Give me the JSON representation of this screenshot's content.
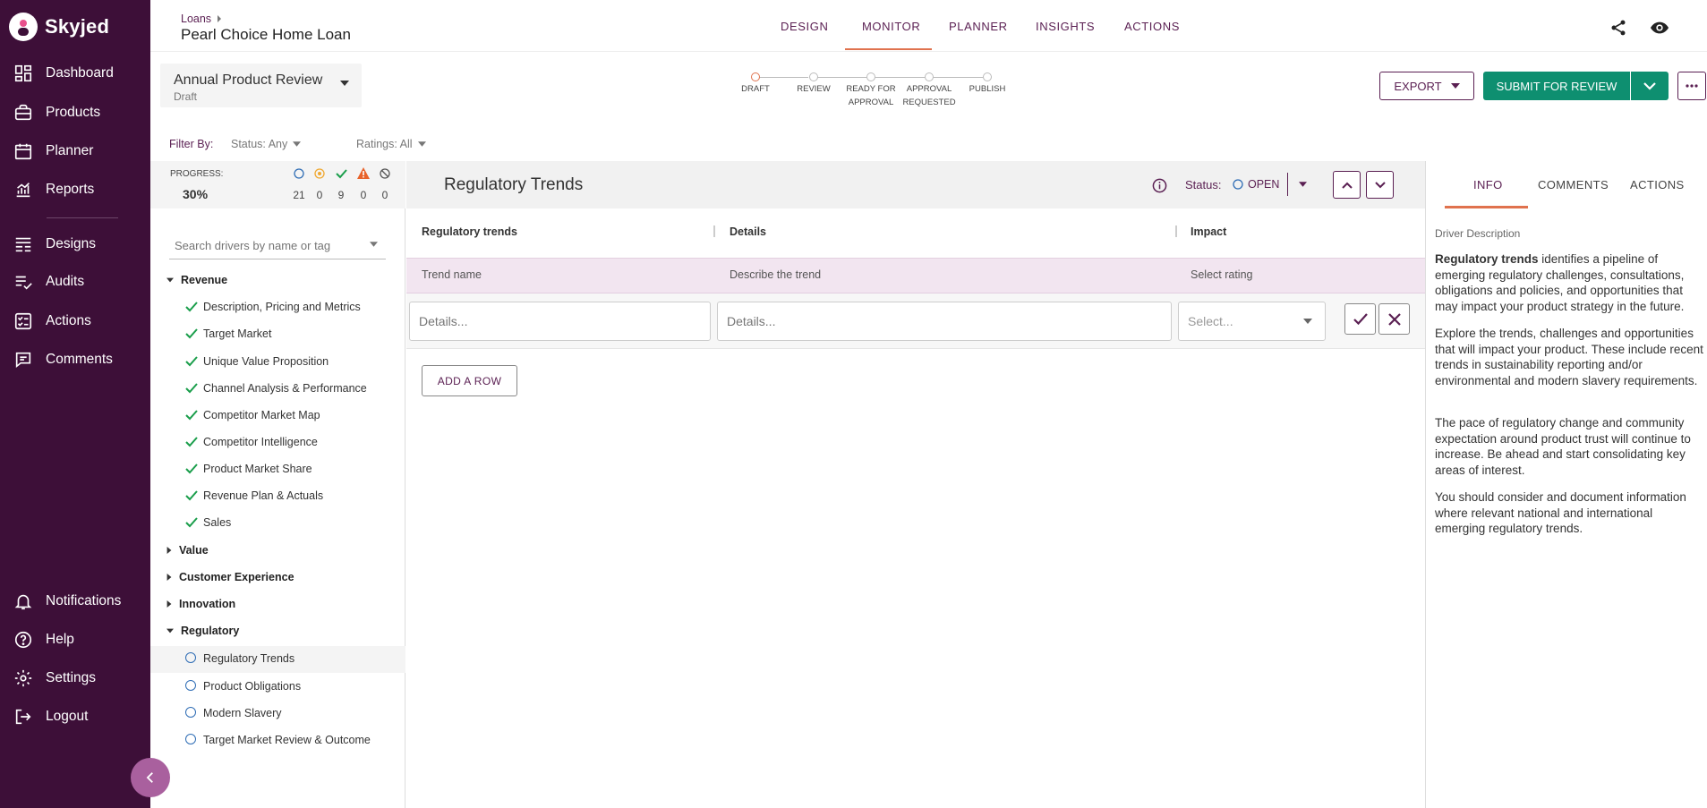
{
  "app": {
    "name": "Skyjed"
  },
  "sidebar": {
    "items": [
      {
        "label": "Dashboard",
        "icon": "dashboard-icon"
      },
      {
        "label": "Products",
        "icon": "products-icon"
      },
      {
        "label": "Planner",
        "icon": "calendar-icon"
      },
      {
        "label": "Reports",
        "icon": "reports-icon"
      },
      {
        "label": "Designs",
        "icon": "designs-icon"
      },
      {
        "label": "Audits",
        "icon": "audits-icon"
      },
      {
        "label": "Actions",
        "icon": "actions-icon"
      },
      {
        "label": "Comments",
        "icon": "comments-icon"
      }
    ],
    "bottom": [
      {
        "label": "Notifications",
        "icon": "bell-icon"
      },
      {
        "label": "Help",
        "icon": "help-icon"
      },
      {
        "label": "Settings",
        "icon": "gear-icon"
      },
      {
        "label": "Logout",
        "icon": "logout-icon"
      }
    ]
  },
  "header": {
    "breadcrumb": "Loans",
    "title": "Pearl Choice Home Loan",
    "tabs": [
      "DESIGN",
      "MONITOR",
      "PLANNER",
      "INSIGHTS",
      "ACTIONS"
    ],
    "active_tab": "MONITOR"
  },
  "review": {
    "title": "Annual Product Review",
    "subtitle": "Draft"
  },
  "stepper": {
    "steps": [
      {
        "label": "DRAFT",
        "label2": ""
      },
      {
        "label": "REVIEW",
        "label2": ""
      },
      {
        "label": "READY FOR",
        "label2": "APPROVAL"
      },
      {
        "label": "APPROVAL",
        "label2": "REQUESTED"
      },
      {
        "label": "PUBLISH",
        "label2": ""
      }
    ],
    "current": 0
  },
  "actions": {
    "export": "EXPORT",
    "submit": "SUBMIT FOR REVIEW"
  },
  "filter": {
    "label": "Filter By:",
    "status": "Status: Any",
    "ratings": "Ratings: All"
  },
  "progress": {
    "label": "PROGRESS:",
    "percent": "30%",
    "counts": [
      "21",
      "0",
      "9",
      "0",
      "0"
    ]
  },
  "search": {
    "placeholder": "Search drivers by name or tag"
  },
  "tree": {
    "revenue": {
      "label": "Revenue",
      "items": [
        "Description, Pricing and Metrics",
        "Target Market",
        "Unique Value Proposition",
        "Channel Analysis & Performance",
        "Competitor Market Map",
        "Competitor Intelligence",
        "Product Market Share",
        "Revenue Plan & Actuals",
        "Sales"
      ]
    },
    "value": "Value",
    "customer_experience": "Customer Experience",
    "innovation": "Innovation",
    "regulatory": {
      "label": "Regulatory",
      "items": [
        "Regulatory Trends",
        "Product Obligations",
        "Modern Slavery",
        "Target Market Review & Outcome"
      ]
    }
  },
  "main": {
    "title": "Regulatory Trends",
    "status_label": "Status:",
    "status_value": "OPEN",
    "columns": [
      "Regulatory trends",
      "Details",
      "Impact"
    ],
    "placeholder_row": [
      "Trend name",
      "Describe the trend",
      "Select rating"
    ],
    "inputs": {
      "trend": "Details...",
      "details": "Details...",
      "impact": "Select..."
    },
    "add_row": "ADD A ROW"
  },
  "right_panel": {
    "tabs": [
      "INFO",
      "COMMENTS",
      "ACTIONS"
    ],
    "active_tab": "INFO",
    "heading": "Driver Description",
    "p1_bold": "Regulatory trends",
    "p1_rest": " identifies a pipeline of emerging regulatory challenges, consultations, obligations and policies, and opportunities that may impact your product strategy in the future.",
    "p2": "Explore the trends, challenges and opportunities that will impact your product. These include recent trends in sustainability reporting and/or environmental and modern slavery requirements.",
    "p3": "The pace of regulatory change and community expectation around product trust will continue to increase. Be ahead and start consolidating key areas of interest.",
    "p4": "You should consider and document information where relevant national and international emerging regulatory trends."
  },
  "colors": {
    "sidebar": "#3d0f38",
    "accent": "#5a1f52",
    "green": "#0e8f70",
    "tab_underline": "#e0724e",
    "warning": "#e8622a",
    "pending": "#f0a830"
  }
}
